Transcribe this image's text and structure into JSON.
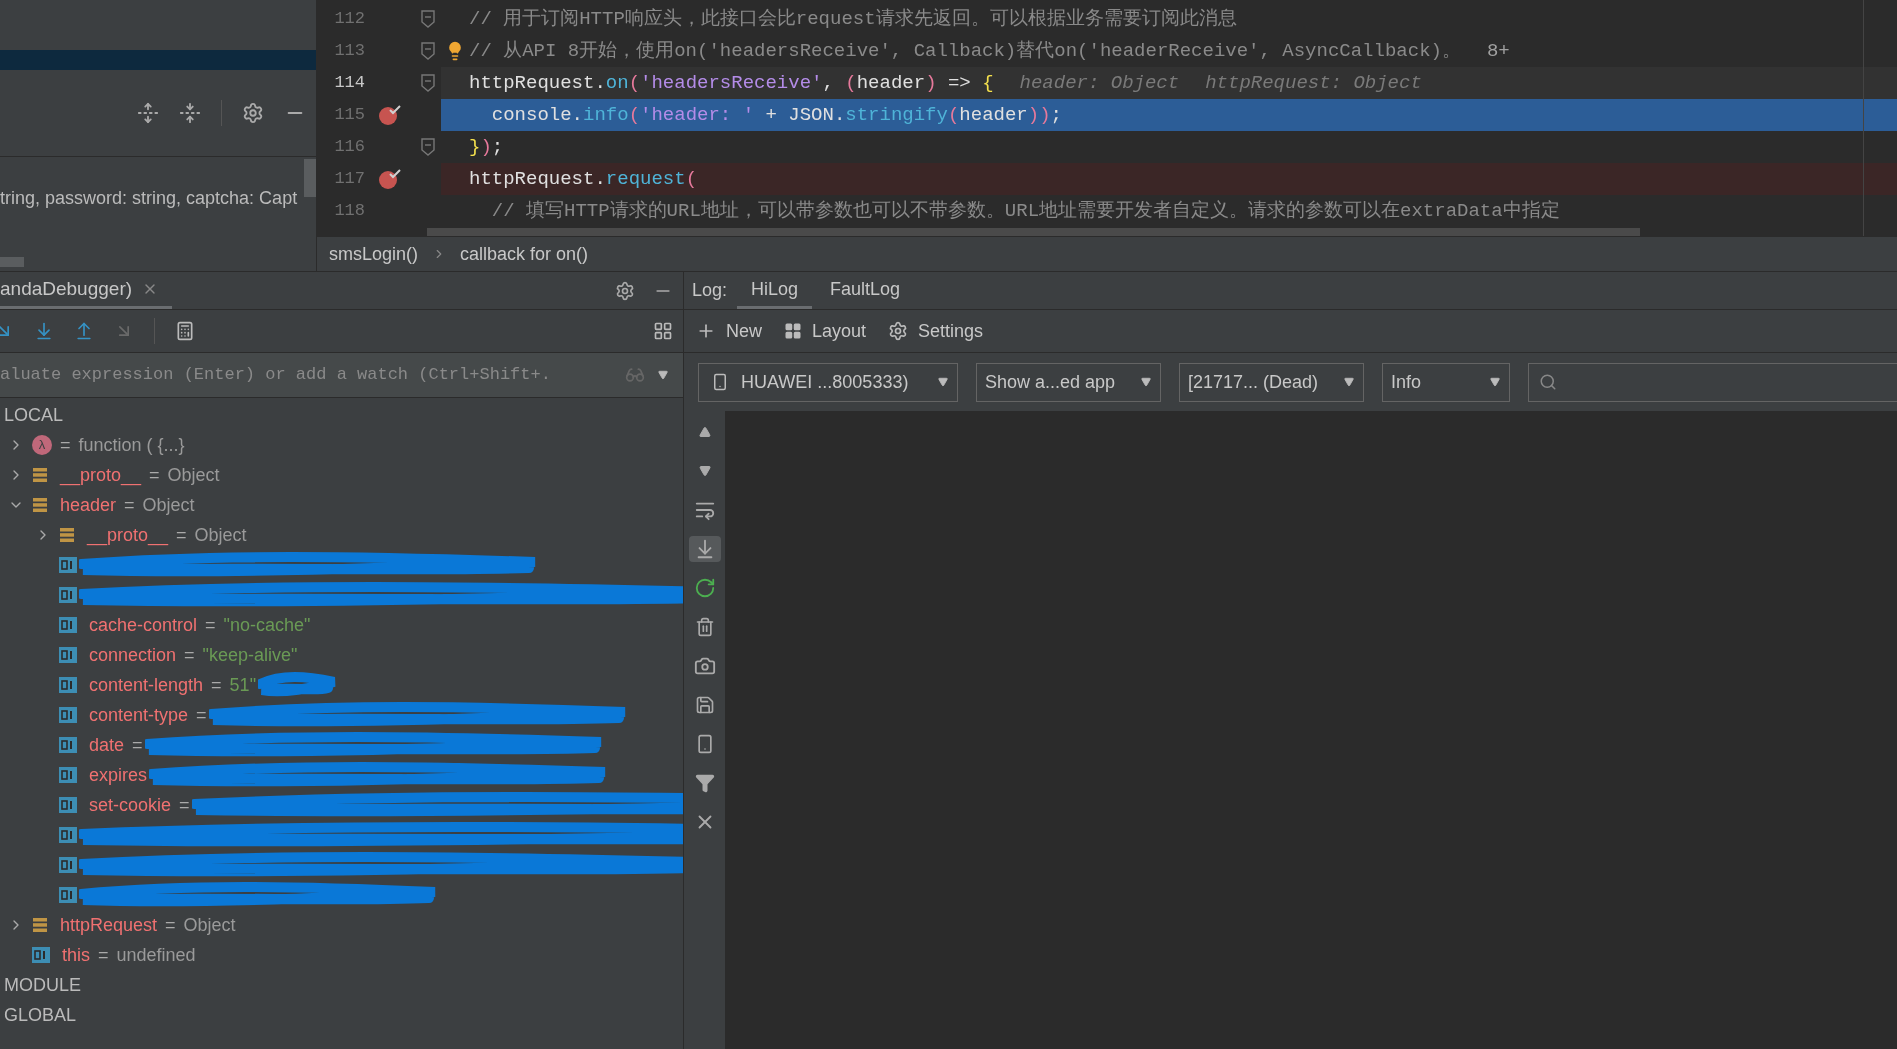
{
  "structure_panel": {
    "signature_text": "tring, password: string, captcha: Capt"
  },
  "editor": {
    "lines": [
      {
        "number": "112",
        "fold": true,
        "bulb": false,
        "breakpoint": false,
        "caret_line": false,
        "execution": false,
        "tokens": [
          {
            "kind": "comment",
            "text": "// 用于订阅HTTP响应头，此接口会比request请求先返回。可以根据业务需要订阅此消息"
          }
        ]
      },
      {
        "number": "113",
        "fold": true,
        "bulb": true,
        "breakpoint": false,
        "caret_line": false,
        "execution": false,
        "tokens": [
          {
            "kind": "comment",
            "text": "// 从API 8开始，使用on('headersReceive', Callback)替代on('headerReceive', AsyncCallback)。"
          }
        ],
        "hints": [
          "8+"
        ]
      },
      {
        "number": "114",
        "fold": true,
        "bulb": false,
        "breakpoint": false,
        "caret_line": true,
        "execution": false,
        "tokens": [
          {
            "kind": "plain",
            "text": "httpRequest."
          },
          {
            "kind": "method",
            "text": "on"
          },
          {
            "kind": "paren",
            "text": "("
          },
          {
            "kind": "string",
            "text": "'headersReceive'"
          },
          {
            "kind": "plain",
            "text": ", "
          },
          {
            "kind": "paren",
            "text": "("
          },
          {
            "kind": "plain",
            "text": "header"
          },
          {
            "kind": "paren",
            "text": ")"
          },
          {
            "kind": "plain",
            "text": " => "
          },
          {
            "kind": "brace",
            "text": "{"
          }
        ],
        "hints": [
          "header: Object",
          "httpRequest: Object"
        ]
      },
      {
        "number": "115",
        "fold": false,
        "bulb": false,
        "breakpoint": true,
        "caret_line": false,
        "execution": true,
        "tokens": [
          {
            "kind": "plain",
            "text": "  console."
          },
          {
            "kind": "method",
            "text": "info"
          },
          {
            "kind": "paren",
            "text": "("
          },
          {
            "kind": "string",
            "text": "'header: '"
          },
          {
            "kind": "plain",
            "text": " + JSON."
          },
          {
            "kind": "method",
            "text": "stringify"
          },
          {
            "kind": "paren",
            "text": "("
          },
          {
            "kind": "plain",
            "text": "header"
          },
          {
            "kind": "paren",
            "text": "))"
          },
          {
            "kind": "plain",
            "text": ";"
          }
        ]
      },
      {
        "number": "116",
        "fold": true,
        "bulb": false,
        "breakpoint": false,
        "caret_line": false,
        "execution": false,
        "tokens": [
          {
            "kind": "brace",
            "text": "}"
          },
          {
            "kind": "paren",
            "text": ")"
          },
          {
            "kind": "plain",
            "text": ";"
          }
        ]
      },
      {
        "number": "117",
        "fold": false,
        "bulb": false,
        "breakpoint": true,
        "caret_line": false,
        "execution": false,
        "tokens": [
          {
            "kind": "plain",
            "text": "httpRequest."
          },
          {
            "kind": "method",
            "text": "request"
          },
          {
            "kind": "paren",
            "text": "("
          }
        ]
      },
      {
        "number": "118",
        "fold": false,
        "bulb": false,
        "breakpoint": false,
        "caret_line": false,
        "execution": false,
        "tokens": [
          {
            "kind": "comment",
            "text": "  // 填写HTTP请求的URL地址，可以带参数也可以不带参数。URL地址需要开发者自定义。请求的参数可以在extraData中指定"
          }
        ]
      }
    ],
    "breadcrumbs": [
      "smsLogin()",
      "callback for on()"
    ]
  },
  "debugger": {
    "tab": "andaDebugger)",
    "evaluate_placeholder": "aluate expression (Enter) or add a watch (Ctrl+Shift+.",
    "variables": [
      {
        "kind": "section",
        "label": "LOCAL",
        "children": [
          {
            "kind": "function",
            "icon": "λ",
            "op": "=",
            "value": "function ( {...}",
            "quoted": false,
            "expanded": false
          },
          {
            "kind": "object",
            "name": "__proto__",
            "op": "=",
            "value": "Object",
            "quoted": false,
            "expanded": false
          },
          {
            "kind": "object",
            "name": "header",
            "op": "=",
            "value": "Object",
            "quoted": false,
            "expanded": true,
            "children": [
              {
                "kind": "object",
                "name": "__proto__",
                "op": "=",
                "value": "Object",
                "quoted": false,
                "expanded": false
              },
              {
                "kind": "primitive",
                "redacted": true
              },
              {
                "kind": "primitive",
                "redacted": true
              },
              {
                "kind": "primitive",
                "name": "cache-control",
                "op": "=",
                "value": "\"no-cache\"",
                "quoted": true,
                "redacted": false
              },
              {
                "kind": "primitive",
                "name": "connection",
                "op": "=",
                "value": "\"keep-alive\"",
                "quoted": true,
                "redacted": false
              },
              {
                "kind": "primitive",
                "name": "content-length",
                "op": "=",
                "value": "51\"",
                "quoted": true,
                "redacted": true
              },
              {
                "kind": "primitive",
                "name": "content-type",
                "op": "=",
                "redacted": true
              },
              {
                "kind": "primitive",
                "name": "date",
                "op": "=",
                "redacted": true
              },
              {
                "kind": "primitive",
                "name": "expires",
                "redacted": true
              },
              {
                "kind": "primitive",
                "name": "set-cookie",
                "op": "=",
                "redacted": true
              },
              {
                "kind": "primitive",
                "redacted": true
              },
              {
                "kind": "primitive",
                "redacted": true
              },
              {
                "kind": "primitive",
                "redacted": true
              }
            ]
          },
          {
            "kind": "object",
            "name": "httpRequest",
            "op": "=",
            "value": "Object",
            "quoted": false,
            "expanded": false
          },
          {
            "kind": "primitive",
            "name": "this",
            "op": "=",
            "value": "undefined",
            "quoted": false,
            "redacted": false
          }
        ]
      },
      {
        "kind": "section",
        "label": "MODULE"
      },
      {
        "kind": "section",
        "label": "GLOBAL"
      }
    ]
  },
  "log": {
    "label": "Log:",
    "tabs": [
      {
        "label": "HiLog",
        "selected": true
      },
      {
        "label": "FaultLog",
        "selected": false
      }
    ],
    "toolbar": [
      {
        "kind": "new",
        "label": "New"
      },
      {
        "kind": "layout",
        "label": "Layout"
      },
      {
        "kind": "settings",
        "label": "Settings"
      }
    ],
    "filters": [
      {
        "kind": "device",
        "value": "HUAWEI ...8005333)"
      },
      {
        "kind": "select",
        "value": "Show a...ed app"
      },
      {
        "kind": "select",
        "value": "[21717... (Dead)"
      },
      {
        "kind": "select",
        "value": "Info"
      }
    ],
    "side_tools": [
      {
        "kind": "up",
        "active": false
      },
      {
        "kind": "down",
        "active": false
      },
      {
        "kind": "wrap",
        "active": false
      },
      {
        "kind": "scroll-end",
        "active": true
      },
      {
        "kind": "restart",
        "active": false
      },
      {
        "kind": "clear",
        "active": false
      },
      {
        "kind": "screenshot",
        "active": false
      },
      {
        "kind": "save",
        "active": false
      },
      {
        "kind": "device",
        "active": false
      },
      {
        "kind": "filter",
        "active": false
      },
      {
        "kind": "close",
        "active": false
      }
    ]
  }
}
